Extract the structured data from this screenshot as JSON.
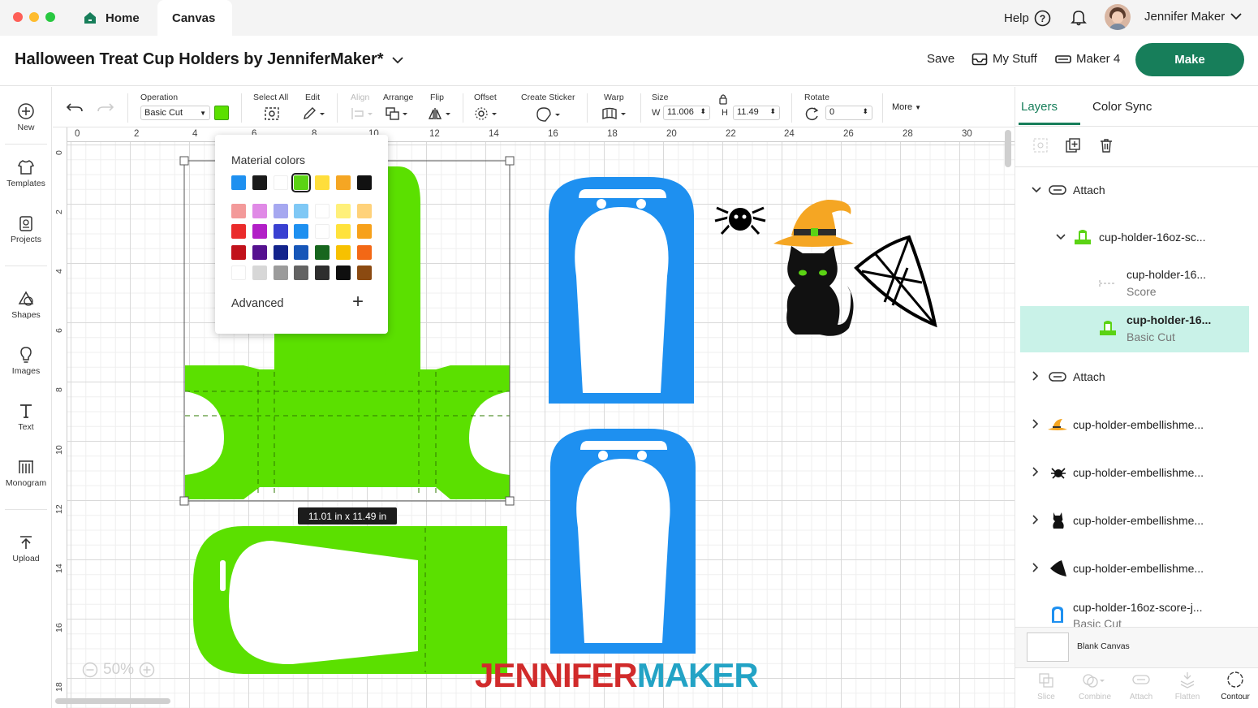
{
  "top": {
    "tabs": [
      "Home",
      "Canvas"
    ],
    "help": "Help",
    "user_name": "Jennifer Maker"
  },
  "title_bar": {
    "doc_title": "Halloween Treat Cup Holders by JenniferMaker*",
    "save": "Save",
    "my_stuff": "My Stuff",
    "machine": "Maker 4",
    "make": "Make"
  },
  "left_sidebar": {
    "items": [
      "New",
      "Templates",
      "Projects",
      "Shapes",
      "Images",
      "Text",
      "Monogram",
      "Upload"
    ]
  },
  "toolbar": {
    "operation_label": "Operation",
    "operation_value": "Basic Cut",
    "operation_color": "#5be000",
    "select_all": "Select All",
    "edit": "Edit",
    "align": "Align",
    "arrange": "Arrange",
    "flip": "Flip",
    "offset": "Offset",
    "create_sticker": "Create Sticker",
    "warp": "Warp",
    "size": "Size",
    "w_label": "W",
    "w_value": "11.006",
    "h_label": "H",
    "h_value": "11.49",
    "rotate": "Rotate",
    "rotate_value": "0",
    "more": "More"
  },
  "canvas": {
    "ruler_x": [
      "0",
      "2",
      "4",
      "6",
      "8",
      "10",
      "12",
      "14",
      "16",
      "18",
      "20",
      "22",
      "24",
      "26",
      "28",
      "30"
    ],
    "ruler_y": [
      "0",
      "2",
      "4",
      "6",
      "8",
      "10",
      "12",
      "14",
      "16",
      "18"
    ],
    "dimension_tag": "11.01  in x 11.49  in",
    "zoom": "50%",
    "watermark_a": "JENNIFER",
    "watermark_b": "MAKER"
  },
  "color_popup": {
    "title": "Material colors",
    "advanced": "Advanced",
    "row1": [
      "#1e90f0",
      "#1a1a1a",
      "#ffffff",
      "#5bd314",
      "#ffde3b",
      "#f5a623",
      "#111111"
    ],
    "grid": [
      [
        "#f39a9a",
        "#e08ae6",
        "#a6a8f0",
        "#7fc8f5",
        "#fff",
        "#fff07a",
        "#ffd27a"
      ],
      [
        "#ea2b2b",
        "#b21fc7",
        "#3940d1",
        "#1e90f0",
        "#fff",
        "#ffe23b",
        "#f7a11a"
      ],
      [
        "#c1121b",
        "#55118f",
        "#13238c",
        "#1656b8",
        "#17661e",
        "#f7c100",
        "#f36815"
      ],
      [
        "#ffffff",
        "#d7d7d7",
        "#9b9b9b",
        "#636363",
        "#2e2e2e",
        "#0f0f0f",
        "#8b4a11"
      ]
    ]
  },
  "layers_panel": {
    "tabs": [
      "Layers",
      "Color Sync"
    ],
    "items": [
      {
        "name": "Attach",
        "sub": ""
      },
      {
        "name": "cup-holder-16oz-sc...",
        "sub": ""
      },
      {
        "name": "cup-holder-16...",
        "sub": "Score"
      },
      {
        "name": "cup-holder-16...",
        "sub": "Basic Cut"
      },
      {
        "name": "Attach",
        "sub": ""
      },
      {
        "name": "cup-holder-embellishme...",
        "sub": ""
      },
      {
        "name": "cup-holder-embellishme...",
        "sub": ""
      },
      {
        "name": "cup-holder-embellishme...",
        "sub": ""
      },
      {
        "name": "cup-holder-embellishme...",
        "sub": ""
      },
      {
        "name": "cup-holder-16oz-score-j...",
        "sub": "Basic Cut"
      }
    ],
    "blank_canvas": "Blank Canvas",
    "bottom_tools": [
      "Slice",
      "Combine",
      "Attach",
      "Flatten",
      "Contour"
    ]
  }
}
